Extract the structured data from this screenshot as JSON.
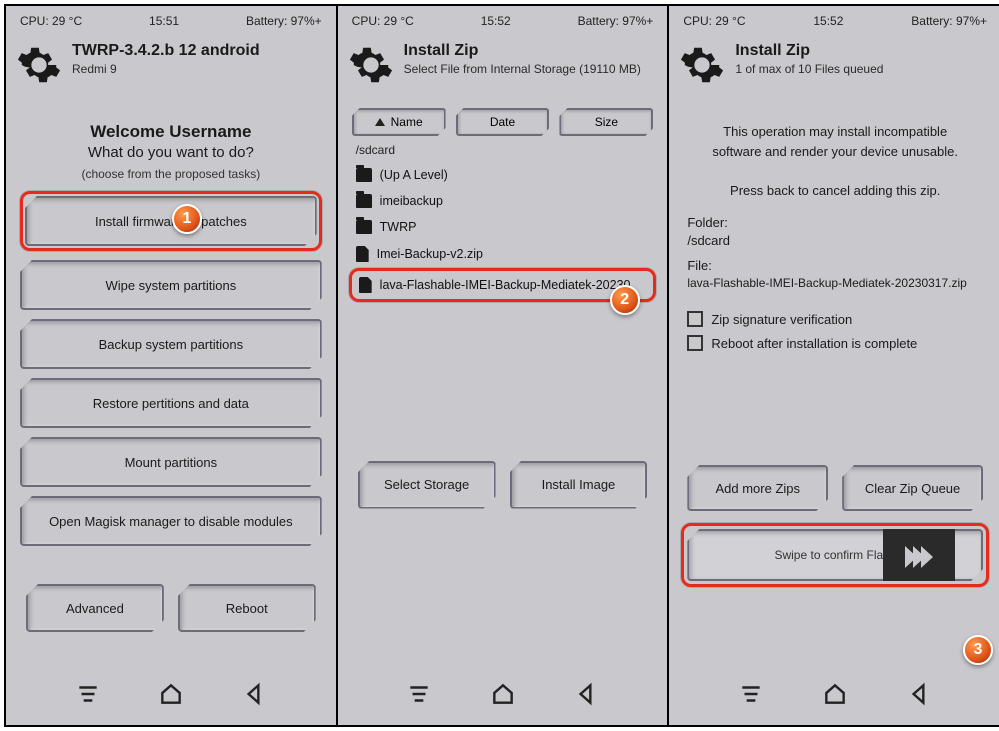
{
  "panels": [
    {
      "status": {
        "cpu": "CPU: 29 °C",
        "time": "15:51",
        "battery": "Battery: 97%+"
      },
      "header": {
        "title": "TWRP-3.4.2.b 12 android",
        "subtitle": "Redmi 9"
      },
      "welcome": {
        "big": "Welcome Username",
        "sub": "What do you want to do?",
        "hint": "(choose from the proposed tasks)"
      },
      "menu": [
        "Install firmware or patches",
        "Wipe system partitions",
        "Backup system partitions",
        "Restore pertitions and data",
        "Mount partitions",
        "Open Magisk manager to disable modules"
      ],
      "bottom": {
        "advanced": "Advanced",
        "reboot": "Reboot"
      }
    },
    {
      "status": {
        "cpu": "CPU: 29 °C",
        "time": "15:52",
        "battery": "Battery: 97%+"
      },
      "header": {
        "title": "Install Zip",
        "subtitle": "Select File from Internal Storage (19110 MB)"
      },
      "sort": {
        "name": "Name",
        "date": "Date",
        "size": "Size"
      },
      "path": "/sdcard",
      "files": [
        {
          "type": "folder",
          "name": "(Up A Level)"
        },
        {
          "type": "folder",
          "name": "imeibackup"
        },
        {
          "type": "folder",
          "name": "TWRP"
        },
        {
          "type": "file",
          "name": "Imei-Backup-v2.zip"
        },
        {
          "type": "file",
          "name": "lava-Flashable-IMEI-Backup-Mediatek-20230"
        }
      ],
      "bottom": {
        "select_storage": "Select Storage",
        "install_image": "Install Image"
      }
    },
    {
      "status": {
        "cpu": "CPU: 29 °C",
        "time": "15:52",
        "battery": "Battery: 97%+"
      },
      "header": {
        "title": "Install Zip",
        "subtitle": "1 of max of 10 Files queued"
      },
      "warn1a": "This operation may install incompatible",
      "warn1b": "software and render your device unusable.",
      "warn2": "Press back to cancel adding this zip.",
      "folder_label": "Folder:",
      "folder_value": "/sdcard",
      "file_label": "File:",
      "file_value": "lava-Flashable-IMEI-Backup-Mediatek-20230317.zip",
      "check1": "Zip signature verification",
      "check2": "Reboot after installation is complete",
      "add_more": "Add more Zips",
      "clear_queue": "Clear Zip Queue",
      "swipe": "Swipe to confirm Flash"
    }
  ],
  "markers": {
    "m1": "1",
    "m2": "2",
    "m3": "3"
  }
}
